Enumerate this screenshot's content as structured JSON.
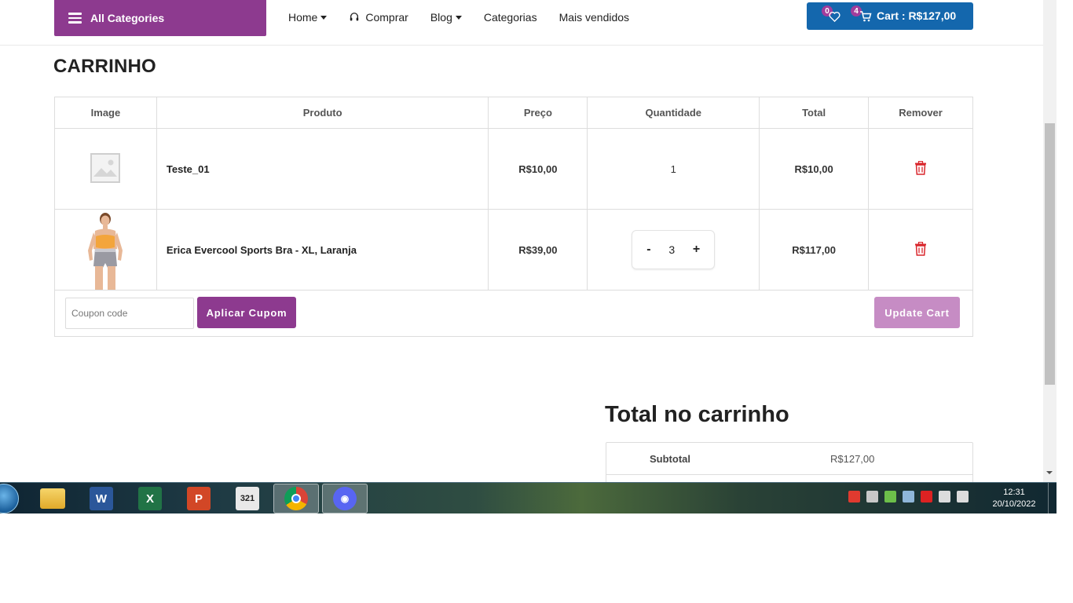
{
  "header": {
    "all_categories_label": "All Categories",
    "nav": [
      {
        "label": "Home",
        "dropdown": true
      },
      {
        "label": "Comprar",
        "icon": "headset-icon"
      },
      {
        "label": "Blog",
        "dropdown": true
      },
      {
        "label": "Categorias"
      },
      {
        "label": "Mais vendidos"
      }
    ],
    "wishlist_count": "0",
    "cart_count": "4",
    "cart_label": "Cart : R$127,00"
  },
  "page": {
    "title": "CARRINHO"
  },
  "table": {
    "headers": [
      "Image",
      "Produto",
      "Preço",
      "Quantidade",
      "Total",
      "Remover"
    ],
    "rows": [
      {
        "product": "Teste_01",
        "price": "R$10,00",
        "quantity": "1",
        "total": "R$10,00",
        "image": "placeholder-image-icon"
      },
      {
        "product": "Erica Evercool Sports Bra - XL, Laranja",
        "price": "R$39,00",
        "quantity": "3",
        "total": "R$117,00",
        "image": "sports-bra-photo"
      }
    ],
    "stepper_minus": "-",
    "stepper_plus": "+"
  },
  "coupon": {
    "placeholder": "Coupon code",
    "apply_label": "Aplicar Cupom",
    "update_label": "Update Cart"
  },
  "totals": {
    "title": "Total no carrinho",
    "subtotal_label": "Subtotal",
    "subtotal_value": "R$127,00"
  },
  "taskbar": {
    "apps": [
      "file-explorer-icon",
      "word-icon",
      "excel-icon",
      "powerpoint-icon",
      "media-player-classic-icon",
      "chrome-icon",
      "discord-icon"
    ],
    "time": "12:31",
    "date": "20/10/2022"
  },
  "colors": {
    "brand_purple": "#8d3a8f",
    "cart_blue": "#1467ad",
    "update_button": "#c68cc4",
    "trash_red": "#d9262c"
  }
}
